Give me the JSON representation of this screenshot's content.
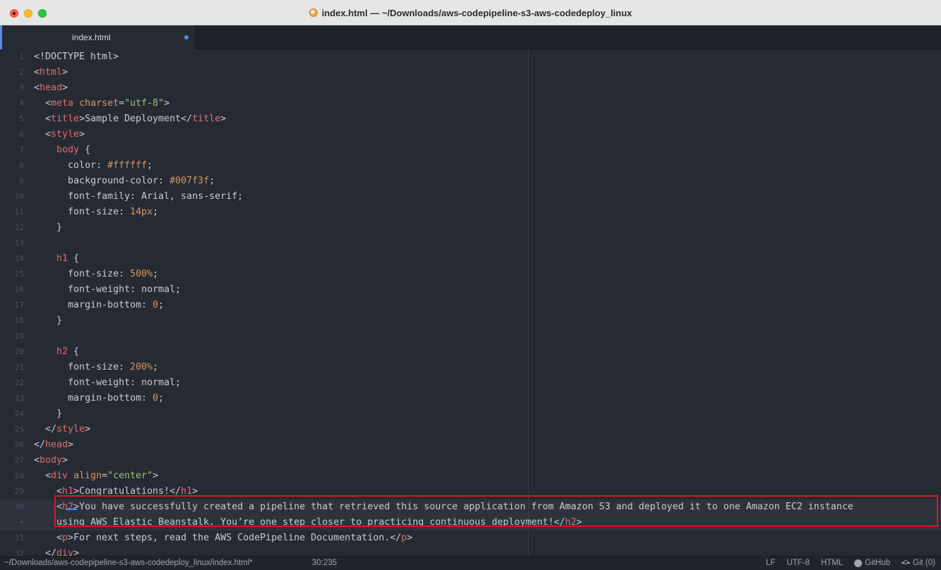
{
  "window": {
    "title": "index.html — ~/Downloads/aws-codepipeline-s3-aws-codedeploy_linux"
  },
  "tabs": [
    {
      "label": "index.html",
      "modified": true,
      "active": true
    }
  ],
  "editor": {
    "line_numbers": [
      "1",
      "2",
      "3",
      "4",
      "5",
      "6",
      "7",
      "8",
      "9",
      "10",
      "11",
      "12",
      "13",
      "14",
      "15",
      "16",
      "17",
      "18",
      "19",
      "20",
      "21",
      "22",
      "23",
      "24",
      "25",
      "26",
      "27",
      "28",
      "29",
      "30",
      "•",
      "31",
      "32"
    ],
    "lines": {
      "l1": "<!DOCTYPE html>",
      "l2_tag": "html",
      "l3_tag": "head",
      "l4_tag": "meta",
      "l4_attr": "charset",
      "l4_val": "\"utf-8\"",
      "l5_open": "title",
      "l5_text": "Sample Deployment",
      "l5_close": "title",
      "l6_tag": "style",
      "l7_sel": "body",
      "l8_prop": "color:",
      "l8_val": "#ffffff",
      "l9_prop": "background-color:",
      "l9_val": "#007f3f",
      "l10_prop": "font-family:",
      "l10_val": "Arial, sans-serif;",
      "l11_prop": "font-size:",
      "l11_val": "14px",
      "l14_sel": "h1",
      "l15_prop": "font-size:",
      "l15_val": "500%",
      "l16_prop": "font-weight:",
      "l16_val": "normal;",
      "l17_prop": "margin-bottom:",
      "l17_val": "0",
      "l20_sel": "h2",
      "l21_prop": "font-size:",
      "l21_val": "200%",
      "l22_prop": "font-weight:",
      "l22_val": "normal;",
      "l23_prop": "margin-bottom:",
      "l23_val": "0",
      "l25_tag": "style",
      "l26_tag": "head",
      "l27_tag": "body",
      "l28_tag": "div",
      "l28_attr": "align",
      "l28_val": "\"center\"",
      "l29_open": "h1",
      "l29_text": "Congratulations!",
      "l29_close": "h1",
      "l30_open": "h2",
      "l30_text": "You have successfully created a pipeline that retrieved this source application from Amazon S3 and deployed it to one Amazon EC2 instance",
      "l30b_text": "using AWS Elastic Beanstalk. You’re one step closer to practicing continuous deployment!",
      "l30b_close": "h2",
      "l31_open": "p",
      "l31_text": "For next steps, read the AWS CodePipeline Documentation.",
      "l31_close": "p",
      "l32_tag": "div"
    }
  },
  "statusbar": {
    "path": "~/Downloads/aws-codepipeline-s3-aws-codedeploy_linux/index.html*",
    "cursor_position": "30:235",
    "line_ending": "LF",
    "encoding": "UTF-8",
    "grammar": "HTML",
    "github_label": "GitHub",
    "git_label": "Git (0)"
  }
}
